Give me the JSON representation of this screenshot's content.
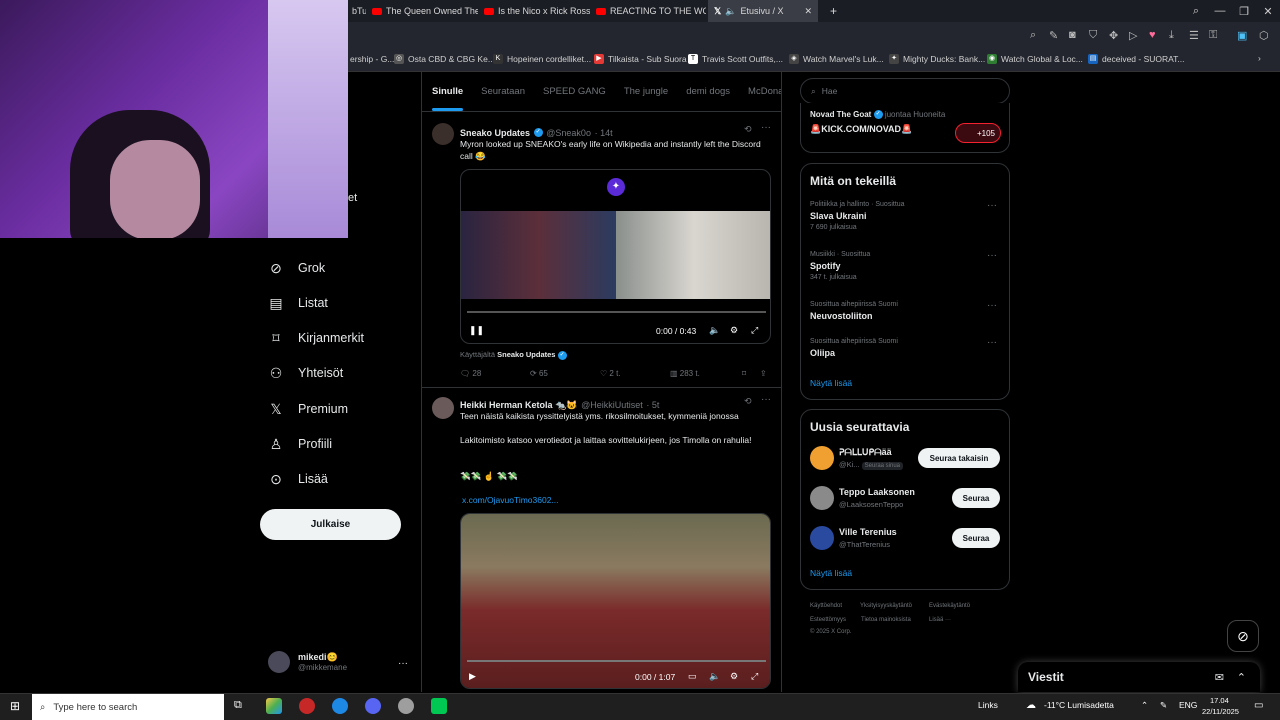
{
  "browser": {
    "tabs": [
      {
        "label": "bTu",
        "active": false
      },
      {
        "label": "The Queen Owned The M",
        "active": false
      },
      {
        "label": "Is the Nico x Rick Ross fa",
        "active": false
      },
      {
        "label": "REACTING TO THE WORST",
        "active": false
      },
      {
        "label": "Etusivu / X",
        "active": true
      }
    ],
    "new_tab": "+",
    "bookmarks": [
      "ership - G...",
      "Osta CBD & CBG Ke...",
      "Hopeinen cordelliket...",
      "Tilkaista - Sub Suora",
      "Travis Scott Outfits,...",
      "Watch Marvel's Luk...",
      "Mighty Ducks: Bank...",
      "Watch Global & Loc...",
      "deceived - SUORAT..."
    ]
  },
  "webcam_text": "et",
  "nav": {
    "partial_top": "Viestit",
    "items": [
      {
        "icon": "grok-icon",
        "glyph": "⊘",
        "label": "Grok"
      },
      {
        "icon": "lists-icon",
        "glyph": "▤",
        "label": "Listat"
      },
      {
        "icon": "bookmark-icon",
        "glyph": "⌑",
        "label": "Kirjanmerkit"
      },
      {
        "icon": "communities-icon",
        "glyph": "⚇",
        "label": "Yhteisöt"
      },
      {
        "icon": "x-premium-icon",
        "glyph": "𝕏",
        "label": "Premium"
      },
      {
        "icon": "profile-icon",
        "glyph": "♙",
        "label": "Profiili"
      },
      {
        "icon": "more-icon",
        "glyph": "⊙",
        "label": "Lisää"
      }
    ],
    "post_button": "Julkaise",
    "user": {
      "name": "mikedi😊",
      "handle": "@mikkemane",
      "more": "···"
    }
  },
  "timeline": {
    "tabs": [
      "Sinulle",
      "Seurataan",
      "SPEED GANG",
      "The jungle",
      "demi dogs",
      "McDonal"
    ],
    "tweets": [
      {
        "name": "Sneako Updates",
        "handle": "@Sneak0o",
        "time": "· 14t",
        "text": "Myron looked up SNEAKO's early life on Wikipedia and instantly left the Discord call 😂",
        "video_time": "0:00 / 0:43",
        "source_prefix": "Käyttäjältä",
        "source_name": "Sneako Updates",
        "replies": "28",
        "reposts": "65",
        "likes": "2 t.",
        "views": "283 t."
      },
      {
        "name": "Heikki Herman Ketola 🐀😺",
        "handle": "@HeikkiUutiset",
        "time": "· 5t",
        "text": "Teen näistä kaikista ryssittelyistä yms. rikosilmoitukset, kymmeniä jonossa",
        "text2": "Lakitoimisto katsoo verotiedot ja laittaa sovittelukirjeen, jos Timolla on rahulia!",
        "emoji": "💸💸 ☝ 💸💸",
        "link": "x.com/OjavuoTimo3602...",
        "video_time": "0:00 / 1:07"
      }
    ]
  },
  "right": {
    "search_placeholder": "Hae",
    "live": {
      "name": "Novad The Goat",
      "suffix": "juontaa Huoneita",
      "title": "🚨KICK.COM/NOVAD🚨",
      "count": "+105"
    },
    "trends_title": "Mitä on tekeillä",
    "trends": [
      {
        "meta": "Politiikka ja hallinto · Suosittua",
        "name": "Slava Ukraini",
        "count": "7 690 julkaisua"
      },
      {
        "meta": "Musiikki · Suosittua",
        "name": "Spotify",
        "count": "347 t. julkaisua"
      },
      {
        "meta": "Suosittua aihepiirissä Suomi",
        "name": "Neuvostoliiton",
        "count": ""
      },
      {
        "meta": "Suosittua aihepiirissä Suomi",
        "name": "Oliipa",
        "count": ""
      }
    ],
    "show_more": "Näytä lisää",
    "who_title": "Uusia seurattavia",
    "who": [
      {
        "name": "ᕈᗩᒪᒪᑌᑭᗩää",
        "handle": "@Ki...",
        "badge": "Seuraa sinua",
        "button": "Seuraa takaisin"
      },
      {
        "name": "Teppo Laaksonen",
        "handle": "@LaaksosenTeppo",
        "button": "Seuraa"
      },
      {
        "name": "Ville Terenius",
        "handle": "@ThatTerenius",
        "button": "Seuraa"
      }
    ],
    "footer": [
      "Käyttöehdot",
      "Yksityisyyskäytäntö",
      "Evästekäytäntö",
      "Esteettömyys",
      "Tietoa mainoksista",
      "Lisää ···",
      "© 2025 X Corp."
    ]
  },
  "messages": {
    "title": "Viestit"
  },
  "taskbar": {
    "search": "Type here to search",
    "links": "Links",
    "weather": "-11°C  Lumisadetta",
    "lang": "ENG",
    "time": "17.04",
    "date": "22/11/2025"
  },
  "colors": {
    "accent": "#1d9bf0",
    "bg": "#000000",
    "border": "#2f3336",
    "live_red": "#f4212e"
  }
}
